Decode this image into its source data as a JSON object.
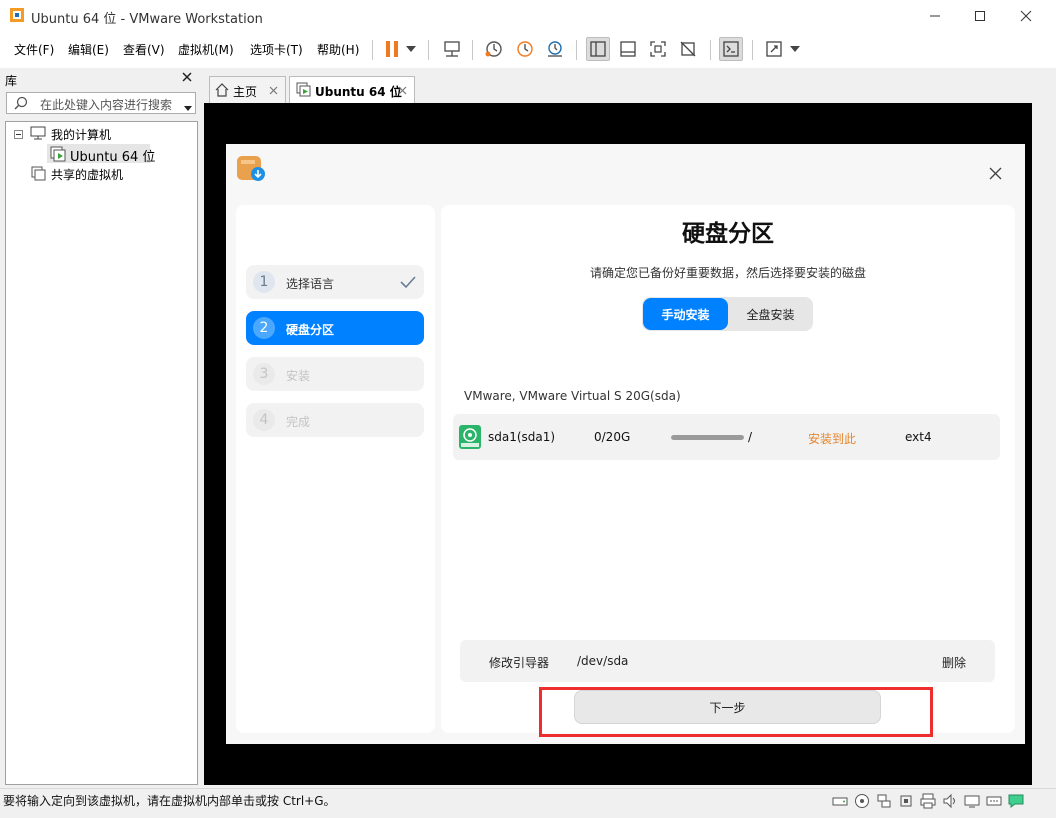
{
  "window": {
    "title": "Ubuntu 64 位 - VMware Workstation"
  },
  "menu": {
    "file": "文件(F)",
    "edit": "编辑(E)",
    "view": "查看(V)",
    "vm": "虚拟机(M)",
    "tabs": "选项卡(T)",
    "help": "帮助(H)"
  },
  "library": {
    "title": "库",
    "search_placeholder": "在此处键入内容进行搜索",
    "my_computer": "我的计算机",
    "vm_name": "Ubuntu 64 位",
    "shared": "共享的虚拟机"
  },
  "tabs": [
    {
      "label": "主页"
    },
    {
      "label": "Ubuntu 64 位"
    }
  ],
  "installer": {
    "steps": [
      {
        "num": "1",
        "label": "选择语言"
      },
      {
        "num": "2",
        "label": "硬盘分区"
      },
      {
        "num": "3",
        "label": "安装"
      },
      {
        "num": "4",
        "label": "完成"
      }
    ],
    "heading": "硬盘分区",
    "subtitle": "请确定您已备份好重要数据，然后选择要安装的磁盘",
    "mode_manual": "手动安装",
    "mode_full": "全盘安装",
    "disk_name": "VMware, VMware Virtual S 20G(sda)",
    "partition": {
      "name": "sda1(sda1)",
      "usage": "0/20G",
      "usage_fraction": 1.0,
      "mount": "/",
      "action": "安装到此",
      "fs": "ext4"
    },
    "bootloader_label": "修改引导器",
    "bootloader_value": "/dev/sda",
    "delete_label": "删除",
    "next_button": "下一步"
  },
  "statusbar": {
    "message": "要将输入定向到该虚拟机，请在虚拟机内部单击或按 Ctrl+G。"
  },
  "colors": {
    "accent": "#0081ff",
    "warning": "#e5862e",
    "highlight_box": "#ee2e2e",
    "pause_orange": "#f07a20"
  }
}
